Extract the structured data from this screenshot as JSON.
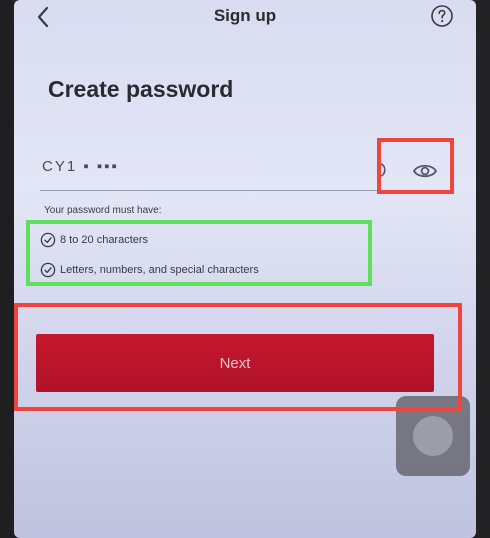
{
  "header": {
    "title": "Sign up",
    "back_icon": "chevron-left-icon",
    "help_icon": "question-circle-icon"
  },
  "page": {
    "title": "Create password"
  },
  "password_field": {
    "value": "CY1 ▪  ▪▪▪",
    "clear_icon": "clear-icon",
    "visibility_icon": "eye-icon"
  },
  "requirements": {
    "heading": "Your password must have:",
    "items": [
      {
        "label": "8 to 20 characters",
        "met": true
      },
      {
        "label": "Letters, numbers, and special characters",
        "met": true
      }
    ]
  },
  "actions": {
    "next_label": "Next"
  },
  "colors": {
    "primary_button": "#c4182e",
    "highlight_red": "#f0443e",
    "highlight_green": "#5fe05a",
    "screen_bg": "#dfe2f4"
  }
}
